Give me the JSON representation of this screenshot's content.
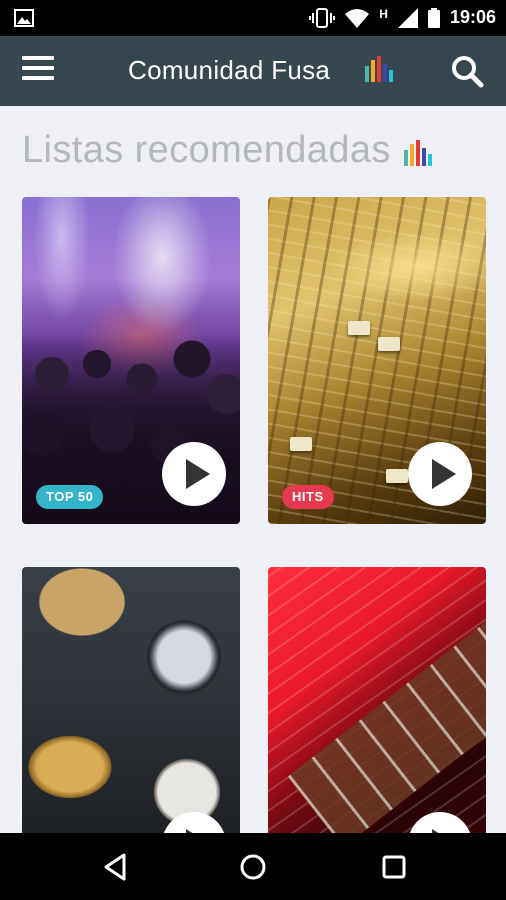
{
  "status_bar": {
    "time": "19:06",
    "network_label": "H",
    "icons": [
      "image-icon",
      "vibrate-icon",
      "wifi-icon",
      "signal-icon",
      "battery-icon"
    ]
  },
  "app_bar": {
    "title": "Comunidad Fusa",
    "icons": [
      "menu-icon",
      "equalizer-icon",
      "search-icon"
    ],
    "background": "#37474f"
  },
  "section": {
    "title": "Listas recomendadas",
    "equalizer_colors": [
      "#4db6ac",
      "#f9a825",
      "#e53935",
      "#3949ab"
    ]
  },
  "playlists": [
    {
      "badge": "TOP 50",
      "badge_color": "#35b3c9",
      "image": "concert crowd"
    },
    {
      "badge": "HITS",
      "badge_color": "#e53950",
      "image": "mixing console"
    },
    {
      "badge": "",
      "image": "drum kit"
    },
    {
      "badge": "",
      "image": "guitar neck"
    }
  ],
  "nav_bar": {
    "icons": [
      "back-icon",
      "home-icon",
      "recents-icon"
    ]
  }
}
